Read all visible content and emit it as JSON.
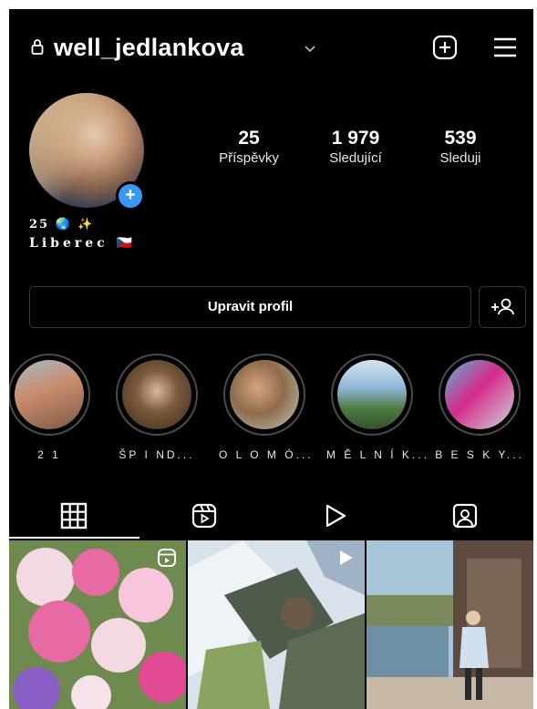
{
  "header": {
    "username": "well_jedlankova",
    "icons": [
      "lock-icon",
      "chevron-down-icon",
      "add-post-icon",
      "menu-icon"
    ]
  },
  "profile": {
    "stats": [
      {
        "value": "25",
        "label": "Příspěvky"
      },
      {
        "value": "1 979",
        "label": "Sledující"
      },
      {
        "value": "539",
        "label": "Sleduji"
      }
    ],
    "bio_line1": "25 🌏 ✨",
    "bio_line2": "Liberec 🇨🇿"
  },
  "actions": {
    "edit_profile_label": "Upravit profil",
    "discover_icon": "add-person-icon"
  },
  "highlights": [
    {
      "title": "2 1",
      "colors": [
        "#c98b6a",
        "#7a5a48",
        "#a7b9c8"
      ]
    },
    {
      "title": "ŠP I ND...",
      "colors": [
        "#3a2a1e",
        "#d9b8a0",
        "#7b5b3d"
      ]
    },
    {
      "title": "O L O M Ó...",
      "colors": [
        "#d7a47e",
        "#8e6b4c",
        "#c0c7b6"
      ]
    },
    {
      "title": "M Ě L N Í K...",
      "colors": [
        "#8fb6d8",
        "#4f7b42",
        "#d8e4ef"
      ]
    },
    {
      "title": "B E S K Y...",
      "colors": [
        "#d52a8a",
        "#5ab8d6",
        "#cfd6dd"
      ]
    }
  ],
  "tabs": [
    "grid-icon",
    "reels-icon",
    "video-icon",
    "tagged-icon"
  ],
  "posts": [
    {
      "type": "reel",
      "colors": [
        "#e86aa5",
        "#f3d9e2",
        "#5a7a3a"
      ]
    },
    {
      "type": "video",
      "colors": [
        "#e9eef3",
        "#4e5b4a",
        "#9fb2c6"
      ]
    },
    {
      "type": "photo",
      "colors": [
        "#a8c4d8",
        "#5e4a3e",
        "#c7b8a8"
      ]
    }
  ],
  "colors": {
    "background": "#000000",
    "accent_blue": "#3897f0",
    "border": "#363636",
    "text": "#ffffff"
  }
}
